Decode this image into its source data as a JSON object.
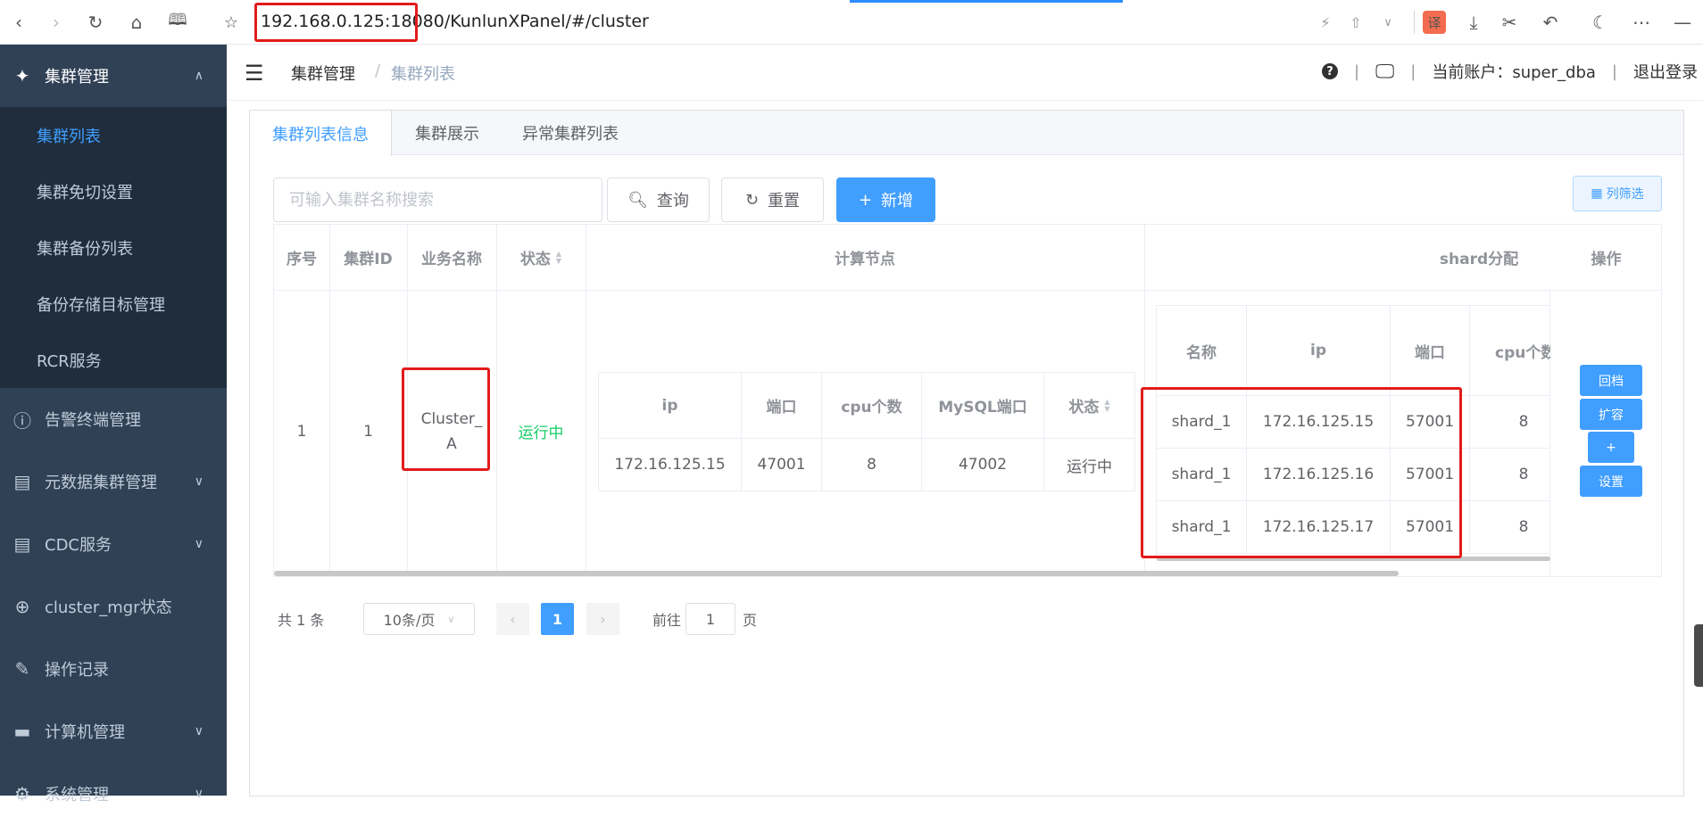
{
  "browser": {
    "url": "192.168.0.125:18080/KunlunXPanel/#/cluster",
    "icons": [
      "back-icon",
      "forward-icon",
      "refresh-icon",
      "home-icon",
      "reader-icon",
      "star-icon",
      "bolt-icon",
      "share-icon",
      "chevron-down-icon",
      "translate-icon",
      "download-icon",
      "scissors-icon",
      "undo-icon",
      "moon-icon",
      "more-icon",
      "minimize-icon"
    ],
    "translate_label": "译"
  },
  "sidebar": {
    "group_title": "集群管理",
    "sub_items": [
      "集群列表",
      "集群免切设置",
      "集群备份列表",
      "备份存储目标管理",
      "RCR服务"
    ],
    "active_sub": "集群列表",
    "top_items": [
      "告警终端管理",
      "元数据集群管理",
      "CDC服务",
      "cluster_mgr状态",
      "操作记录",
      "计算机管理",
      "系统管理"
    ]
  },
  "header": {
    "breadcrumb": [
      "集群管理",
      "集群列表"
    ],
    "breadcrumb_sep": "/",
    "divider": "|",
    "account_label": "当前账户：super_dba",
    "logout": "退出登录",
    "help": "?"
  },
  "tabs": [
    "集群列表信息",
    "集群展示",
    "异常集群列表"
  ],
  "toolbar": {
    "search_placeholder": "可输入集群名称搜索",
    "query": "查询",
    "reset": "重置",
    "add": "新增",
    "column_filter": "列筛选"
  },
  "table": {
    "headers": {
      "index": "序号",
      "cluster_id": "集群ID",
      "biz_name": "业务名称",
      "status": "状态",
      "compute_nodes": "计算节点",
      "shards": "shard分配",
      "ops": "操作"
    },
    "row": {
      "index": "1",
      "cluster_id": "1",
      "biz_name_line1": "Cluster_",
      "biz_name_line2": "A",
      "status": "运行中"
    },
    "compute": {
      "headers": [
        "ip",
        "端口",
        "cpu个数",
        "MySQL端口",
        "状态"
      ],
      "rows": [
        [
          "172.16.125.15",
          "47001",
          "8",
          "47002",
          "运行中"
        ]
      ]
    },
    "shard": {
      "headers": [
        "名称",
        "ip",
        "端口",
        "cpu个数"
      ],
      "rows": [
        [
          "shard_1",
          "172.16.125.15",
          "57001",
          "8"
        ],
        [
          "shard_1",
          "172.16.125.16",
          "57001",
          "8"
        ],
        [
          "shard_1",
          "172.16.125.17",
          "57001",
          "8"
        ]
      ]
    },
    "ops": [
      "回档",
      "扩容",
      "+",
      "设置"
    ]
  },
  "pagination": {
    "total": "共 1 条",
    "page_size": "10条/页",
    "current": "1",
    "goto_prefix": "前往",
    "goto_value": "1",
    "goto_suffix": "页"
  },
  "colors": {
    "primary": "#409eff",
    "sidebar": "#304156",
    "submenu": "#1f2d3d",
    "running": "#13ce66",
    "highlight": "#e21b1b"
  }
}
